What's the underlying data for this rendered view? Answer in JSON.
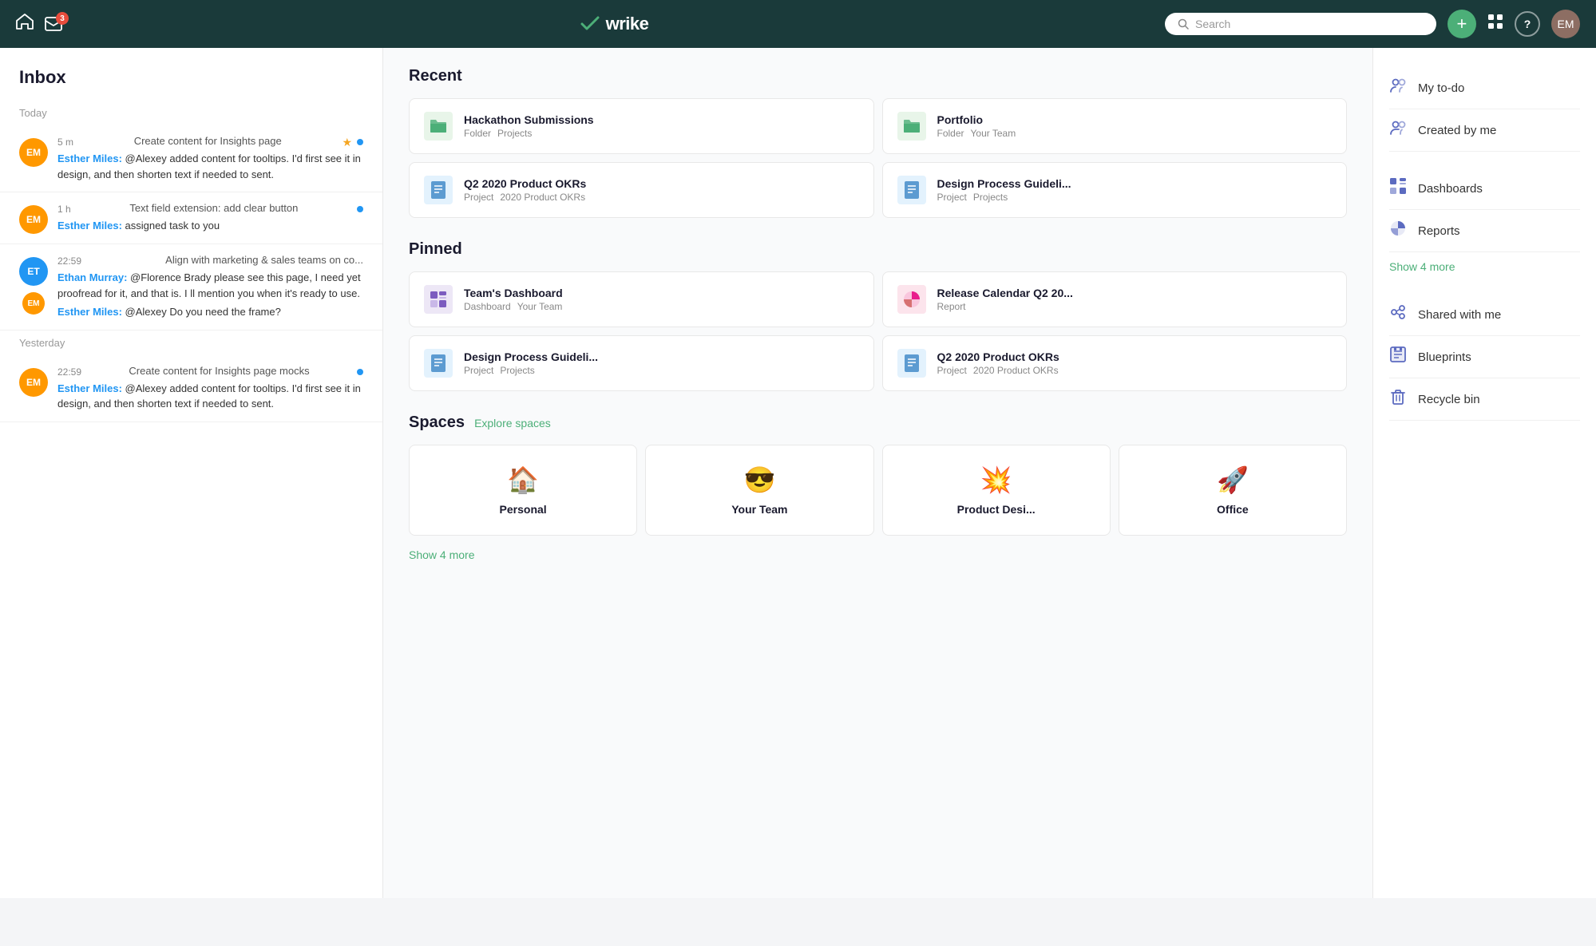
{
  "app": {
    "name": "wrike",
    "logo_check": "✓"
  },
  "topnav": {
    "home_icon": "⌂",
    "inbox_icon": "✉",
    "inbox_badge": "3",
    "search_placeholder": "Search",
    "add_label": "+",
    "grid_label": "⠿",
    "help_label": "?",
    "avatar_initials": "EM"
  },
  "inbox": {
    "title": "Inbox",
    "groups": [
      {
        "label": "Today",
        "items": [
          {
            "time": "5 m",
            "subject": "Create content for Insights page",
            "avatar_initials": "EM",
            "avatar_class": "orange",
            "has_star": true,
            "has_dot": true,
            "message_author": "Esther Miles:",
            "message_text": " @Alexey added content for tooltips. I'd first see it in design, and then shorten text if needed to sent."
          },
          {
            "time": "1 h",
            "subject": "Text field extension: add clear button",
            "avatar_initials": "EM",
            "avatar_class": "orange",
            "has_star": false,
            "has_dot": true,
            "message_author": "Esther Miles:",
            "message_text": " assigned task to you"
          },
          {
            "time": "22:59",
            "subject": "Align with marketing & sales teams on co...",
            "avatar_initials": "ET",
            "avatar_class": "blue",
            "has_star": false,
            "has_dot": false,
            "message_author": "Ethan Murray:",
            "message_text": " @Florence Brady please see this page, I need yet proofread for it, and that is. I ll mention you when it's ready to use.",
            "extra_author": "Esther Miles:",
            "extra_text": " @Alexey Do you need the frame?"
          }
        ]
      },
      {
        "label": "Yesterday",
        "items": [
          {
            "time": "22:59",
            "subject": "Create content for Insights page mocks",
            "avatar_initials": "EM",
            "avatar_class": "orange",
            "has_star": false,
            "has_dot": true,
            "message_author": "Esther Miles:",
            "message_text": " @Alexey added content for tooltips. I'd first see it in design, and then shorten text if needed to sent."
          }
        ]
      }
    ]
  },
  "recent": {
    "title": "Recent",
    "items": [
      {
        "icon_type": "folder",
        "title": "Hackathon Submissions",
        "meta1": "Folder",
        "meta2": "Projects"
      },
      {
        "icon_type": "folder",
        "title": "Portfolio",
        "meta1": "Folder",
        "meta2": "Your Team"
      },
      {
        "icon_type": "project",
        "title": "Q2 2020 Product OKRs",
        "meta1": "Project",
        "meta2": "2020 Product OKRs"
      },
      {
        "icon_type": "project",
        "title": "Design Process Guideli...",
        "meta1": "Project",
        "meta2": "Projects"
      }
    ]
  },
  "pinned": {
    "title": "Pinned",
    "items": [
      {
        "icon_type": "dashboard",
        "title": "Team's Dashboard",
        "meta1": "Dashboard",
        "meta2": "Your Team"
      },
      {
        "icon_type": "report",
        "title": "Release Calendar Q2 20...",
        "meta1": "Report",
        "meta2": ""
      },
      {
        "icon_type": "project",
        "title": "Design Process Guideli...",
        "meta1": "Project",
        "meta2": "Projects"
      },
      {
        "icon_type": "project",
        "title": "Q2 2020 Product OKRs",
        "meta1": "Project",
        "meta2": "2020 Product OKRs"
      }
    ]
  },
  "spaces": {
    "title": "Spaces",
    "explore_label": "Explore spaces",
    "items": [
      {
        "emoji": "🏠",
        "name": "Personal"
      },
      {
        "emoji": "😎",
        "name": "Your Team"
      },
      {
        "emoji": "💥",
        "name": "Product Desi..."
      },
      {
        "emoji": "🚀",
        "name": "Office"
      }
    ],
    "show_more_label": "Show 4 more"
  },
  "right_panel": {
    "items": [
      {
        "icon": "my-todo-icon",
        "icon_char": "👤",
        "label": "My to-do"
      },
      {
        "icon": "created-by-me-icon",
        "icon_char": "👥",
        "label": "Created by me"
      },
      {
        "icon": "dashboards-icon",
        "icon_char": "▦",
        "label": "Dashboards"
      },
      {
        "icon": "reports-icon",
        "icon_char": "◑",
        "label": "Reports"
      }
    ],
    "show_more_label": "Show 4 more",
    "bottom_items": [
      {
        "icon": "shared-with-me-icon",
        "icon_char": "⋈",
        "label": "Shared with me"
      },
      {
        "icon": "blueprints-icon",
        "icon_char": "▤",
        "label": "Blueprints"
      },
      {
        "icon": "recycle-bin-icon",
        "icon_char": "🗑",
        "label": "Recycle bin"
      }
    ]
  }
}
